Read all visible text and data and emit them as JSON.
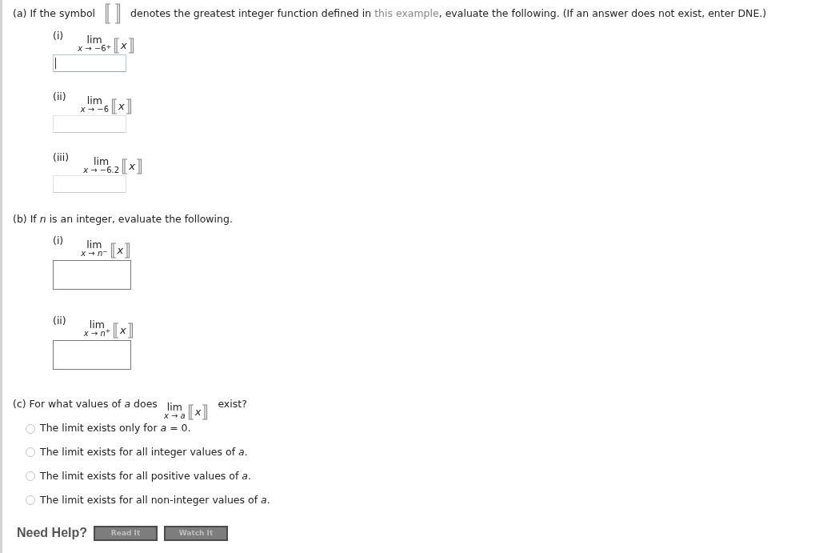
{
  "part_a": {
    "label": "(a) If the symbol",
    "text_before_link": "denotes the greatest integer function defined in ",
    "link": "this example",
    "text_after_link": ", evaluate the following. (If an answer does not exist, enter DNE.)",
    "items": [
      {
        "label": "(i)",
        "lim": "lim",
        "approach": "*x* → −6$^{+}$",
        "variable": "x",
        "focused": true
      },
      {
        "label": "(ii)",
        "lim": "lim",
        "approach": "*x* → −6",
        "variable": "x",
        "focused": false
      },
      {
        "label": "(iii)",
        "lim": "lim",
        "approach": "*x* → −6.2",
        "variable": "x",
        "focused": false
      }
    ]
  },
  "part_b": {
    "text": "(b) If *n* is an integer, evaluate the following.",
    "items": [
      {
        "label": "(i)",
        "lim": "lim",
        "approach": "*x* → *n*$^{−}$",
        "variable": "x"
      },
      {
        "label": "(ii)",
        "lim": "lim",
        "approach": "*x* → *n*$^{+}$",
        "variable": "x"
      }
    ]
  },
  "part_c": {
    "text_before": "(c) For what values of *a* does",
    "lim": "lim",
    "approach": "*x* → *a*",
    "variable": "x",
    "text_after": "exist?",
    "options": [
      {
        "text": "The limit exists only for *a* = 0.",
        "selected": false
      },
      {
        "text": "The limit exists for all integer values of *a*.",
        "selected": false
      },
      {
        "text": "The limit exists for all positive values of *a*.",
        "selected": false
      },
      {
        "text": "The limit exists for all non-integer values of *a*.",
        "selected": false
      }
    ]
  },
  "help": {
    "label": "Need Help?",
    "buttons": [
      "Read It",
      "Watch It"
    ]
  }
}
